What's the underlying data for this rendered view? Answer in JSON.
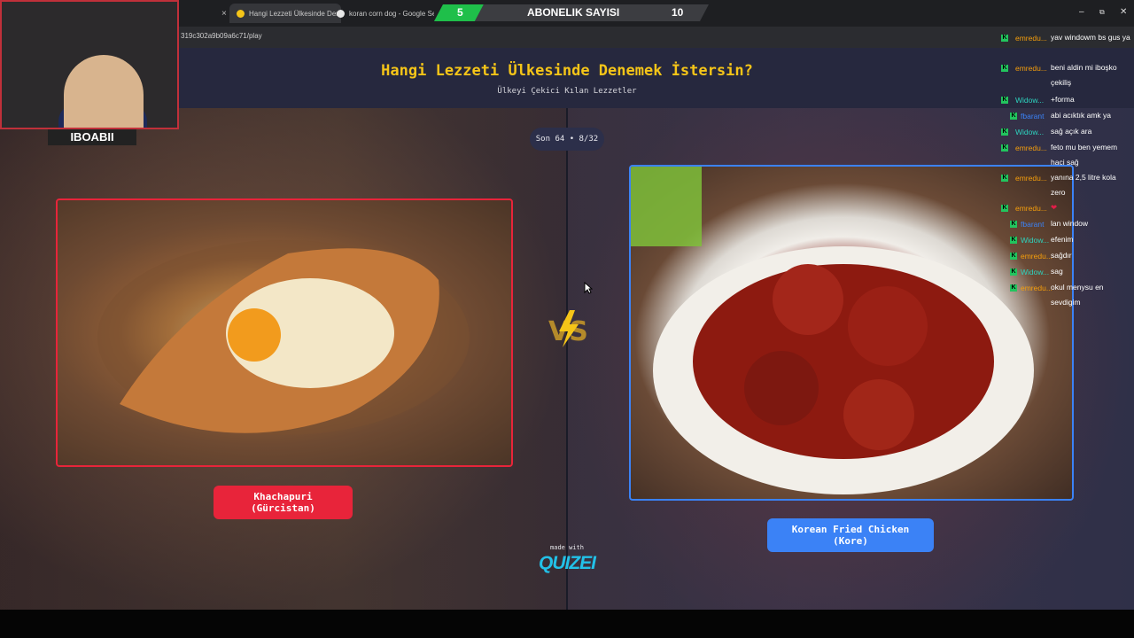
{
  "browser": {
    "tabs": [
      {
        "title": "Hangi Lezzeti Ülkesinde Denem",
        "active": true
      },
      {
        "title": "koran corn dog - Google Searc",
        "active": false
      }
    ],
    "url": "319c302a9b09a6c71/play",
    "window_controls": {
      "minimize": "–",
      "restore": "⧉",
      "close": "✕"
    }
  },
  "subscriber_bar": {
    "label": "ABONELIK SAYISI",
    "current": "5",
    "goal": "10",
    "progress": 0.5,
    "color": "#1fbf4a"
  },
  "streamer": {
    "name": "IBOABII"
  },
  "quiz": {
    "title": "Hangi Lezzeti Ülkesinde Denemek İstersin?",
    "subtitle": "Ülkeyi Çekici Kılan Lezzetler",
    "round": "Son 64 • 8/32",
    "vs": "VS",
    "left": {
      "label": "Khachapuri (Gürcistan)",
      "color": "#e8243a"
    },
    "right": {
      "label": "Korean Fried Chicken (Kore)",
      "color": "#3b82f6"
    },
    "made_with": "made with",
    "brand": "QUIZEI"
  },
  "chat": [
    {
      "user": "emredu...",
      "text": "yav windowm bs gus ya"
    },
    {
      "user": "emredu...",
      "text": "beni aldin mi iboşko çekiliş"
    },
    {
      "user": "Widow...",
      "text": "+forma"
    },
    {
      "user": "fbarant",
      "text": "abi acıktık amk ya"
    },
    {
      "user": "Widow...",
      "text": "sağ açık ara"
    },
    {
      "user": "emredu...",
      "text": "feto mu ben yemem haci sağ"
    },
    {
      "user": "emredu...",
      "text": "yanına 2,5 litre kola zero"
    },
    {
      "user": "emredu...",
      "text": "❤"
    },
    {
      "user": "fbarant",
      "text": "lan window"
    },
    {
      "user": "Widow...",
      "text": "efenim"
    },
    {
      "user": "emredu...",
      "text": "sağdır"
    },
    {
      "user": "Widow...",
      "text": "sag"
    },
    {
      "user": "emredu...",
      "text": "okul menysu en sevdigim"
    }
  ],
  "chat_badge": "K"
}
